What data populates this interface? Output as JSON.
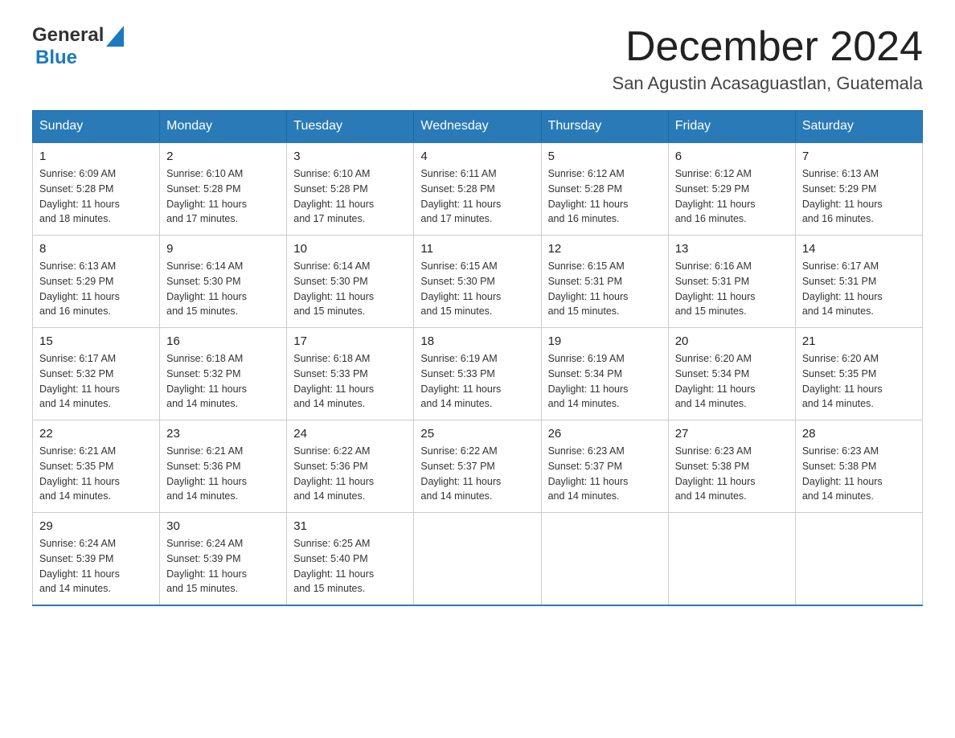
{
  "header": {
    "logo": {
      "text_general": "General",
      "text_blue": "Blue",
      "aria": "GeneralBlue logo"
    },
    "month_title": "December 2024",
    "location": "San Agustin Acasaguastlan, Guatemala"
  },
  "calendar": {
    "days_of_week": [
      "Sunday",
      "Monday",
      "Tuesday",
      "Wednesday",
      "Thursday",
      "Friday",
      "Saturday"
    ],
    "weeks": [
      [
        {
          "day": "1",
          "sunrise": "6:09 AM",
          "sunset": "5:28 PM",
          "daylight": "11 hours and 18 minutes."
        },
        {
          "day": "2",
          "sunrise": "6:10 AM",
          "sunset": "5:28 PM",
          "daylight": "11 hours and 17 minutes."
        },
        {
          "day": "3",
          "sunrise": "6:10 AM",
          "sunset": "5:28 PM",
          "daylight": "11 hours and 17 minutes."
        },
        {
          "day": "4",
          "sunrise": "6:11 AM",
          "sunset": "5:28 PM",
          "daylight": "11 hours and 17 minutes."
        },
        {
          "day": "5",
          "sunrise": "6:12 AM",
          "sunset": "5:28 PM",
          "daylight": "11 hours and 16 minutes."
        },
        {
          "day": "6",
          "sunrise": "6:12 AM",
          "sunset": "5:29 PM",
          "daylight": "11 hours and 16 minutes."
        },
        {
          "day": "7",
          "sunrise": "6:13 AM",
          "sunset": "5:29 PM",
          "daylight": "11 hours and 16 minutes."
        }
      ],
      [
        {
          "day": "8",
          "sunrise": "6:13 AM",
          "sunset": "5:29 PM",
          "daylight": "11 hours and 16 minutes."
        },
        {
          "day": "9",
          "sunrise": "6:14 AM",
          "sunset": "5:30 PM",
          "daylight": "11 hours and 15 minutes."
        },
        {
          "day": "10",
          "sunrise": "6:14 AM",
          "sunset": "5:30 PM",
          "daylight": "11 hours and 15 minutes."
        },
        {
          "day": "11",
          "sunrise": "6:15 AM",
          "sunset": "5:30 PM",
          "daylight": "11 hours and 15 minutes."
        },
        {
          "day": "12",
          "sunrise": "6:15 AM",
          "sunset": "5:31 PM",
          "daylight": "11 hours and 15 minutes."
        },
        {
          "day": "13",
          "sunrise": "6:16 AM",
          "sunset": "5:31 PM",
          "daylight": "11 hours and 15 minutes."
        },
        {
          "day": "14",
          "sunrise": "6:17 AM",
          "sunset": "5:31 PM",
          "daylight": "11 hours and 14 minutes."
        }
      ],
      [
        {
          "day": "15",
          "sunrise": "6:17 AM",
          "sunset": "5:32 PM",
          "daylight": "11 hours and 14 minutes."
        },
        {
          "day": "16",
          "sunrise": "6:18 AM",
          "sunset": "5:32 PM",
          "daylight": "11 hours and 14 minutes."
        },
        {
          "day": "17",
          "sunrise": "6:18 AM",
          "sunset": "5:33 PM",
          "daylight": "11 hours and 14 minutes."
        },
        {
          "day": "18",
          "sunrise": "6:19 AM",
          "sunset": "5:33 PM",
          "daylight": "11 hours and 14 minutes."
        },
        {
          "day": "19",
          "sunrise": "6:19 AM",
          "sunset": "5:34 PM",
          "daylight": "11 hours and 14 minutes."
        },
        {
          "day": "20",
          "sunrise": "6:20 AM",
          "sunset": "5:34 PM",
          "daylight": "11 hours and 14 minutes."
        },
        {
          "day": "21",
          "sunrise": "6:20 AM",
          "sunset": "5:35 PM",
          "daylight": "11 hours and 14 minutes."
        }
      ],
      [
        {
          "day": "22",
          "sunrise": "6:21 AM",
          "sunset": "5:35 PM",
          "daylight": "11 hours and 14 minutes."
        },
        {
          "day": "23",
          "sunrise": "6:21 AM",
          "sunset": "5:36 PM",
          "daylight": "11 hours and 14 minutes."
        },
        {
          "day": "24",
          "sunrise": "6:22 AM",
          "sunset": "5:36 PM",
          "daylight": "11 hours and 14 minutes."
        },
        {
          "day": "25",
          "sunrise": "6:22 AM",
          "sunset": "5:37 PM",
          "daylight": "11 hours and 14 minutes."
        },
        {
          "day": "26",
          "sunrise": "6:23 AM",
          "sunset": "5:37 PM",
          "daylight": "11 hours and 14 minutes."
        },
        {
          "day": "27",
          "sunrise": "6:23 AM",
          "sunset": "5:38 PM",
          "daylight": "11 hours and 14 minutes."
        },
        {
          "day": "28",
          "sunrise": "6:23 AM",
          "sunset": "5:38 PM",
          "daylight": "11 hours and 14 minutes."
        }
      ],
      [
        {
          "day": "29",
          "sunrise": "6:24 AM",
          "sunset": "5:39 PM",
          "daylight": "11 hours and 14 minutes."
        },
        {
          "day": "30",
          "sunrise": "6:24 AM",
          "sunset": "5:39 PM",
          "daylight": "11 hours and 15 minutes."
        },
        {
          "day": "31",
          "sunrise": "6:25 AM",
          "sunset": "5:40 PM",
          "daylight": "11 hours and 15 minutes."
        },
        null,
        null,
        null,
        null
      ]
    ],
    "labels": {
      "sunrise": "Sunrise:",
      "sunset": "Sunset:",
      "daylight": "Daylight:"
    }
  }
}
